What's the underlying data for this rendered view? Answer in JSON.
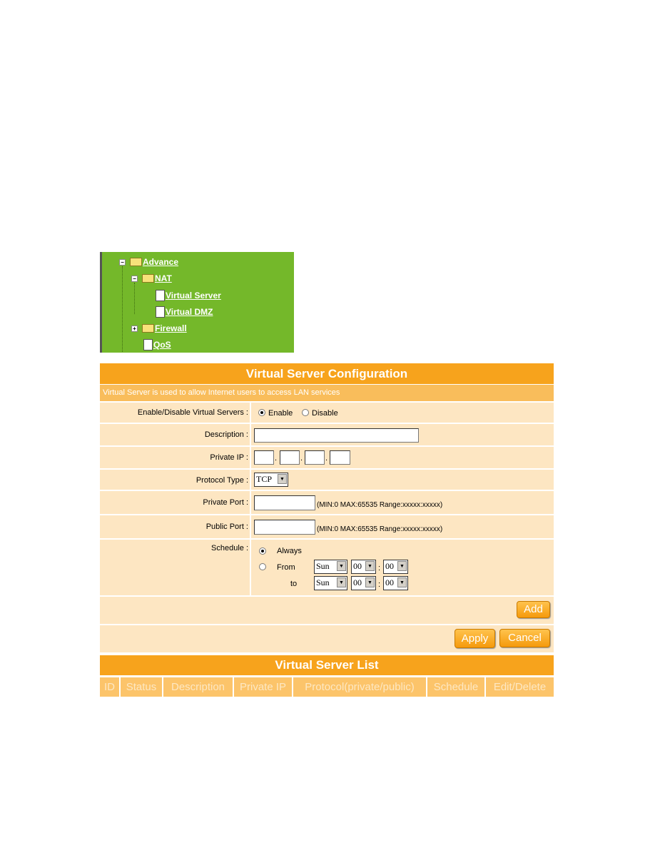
{
  "tree": {
    "items": [
      {
        "label": "Advance",
        "toggle": "−",
        "icon": "folder-open"
      },
      {
        "label": "NAT",
        "toggle": "−",
        "icon": "folder-open"
      },
      {
        "label": "Virtual Server",
        "icon": "document"
      },
      {
        "label": "Virtual DMZ",
        "icon": "document"
      },
      {
        "label": "Firewall",
        "toggle": "+",
        "icon": "folder"
      },
      {
        "label": "QoS",
        "icon": "document"
      }
    ]
  },
  "config": {
    "title": "Virtual Server Configuration",
    "subtitle": "Virtual Server is used to allow Internet users to access LAN services",
    "enable_label": "Enable/Disable Virtual Servers :",
    "enable_opt": "Enable",
    "disable_opt": "Disable",
    "enabled": true,
    "description_label": "Description :",
    "description_value": "",
    "private_ip_label": "Private IP :",
    "private_ip": [
      "",
      "",
      "",
      ""
    ],
    "ip_dot": ".",
    "protocol_label": "Protocol Type :",
    "protocol_value": "TCP",
    "private_port_label": "Private Port :",
    "private_port_value": "",
    "public_port_label": "Public Port :",
    "public_port_value": "",
    "port_hint": "(MIN:0 MAX:65535 Range:xxxxx:xxxxx)",
    "schedule_label": "Schedule :",
    "always": "Always",
    "from": "From",
    "to": "to",
    "colon": ":",
    "from_day": "Sun",
    "from_hour": "00",
    "from_min": "00",
    "to_day": "Sun",
    "to_hour": "00",
    "to_min": "00",
    "add": "Add",
    "apply": "Apply",
    "cancel": "Cancel"
  },
  "list": {
    "title": "Virtual Server List",
    "columns": [
      "ID",
      "Status",
      "Description",
      "Private IP",
      "Protocol(private/public)",
      "Schedule",
      "Edit/Delete"
    ]
  },
  "colors": {
    "header": "#f7a31c",
    "row": "#fde6c2",
    "tree": "#74b82a"
  }
}
